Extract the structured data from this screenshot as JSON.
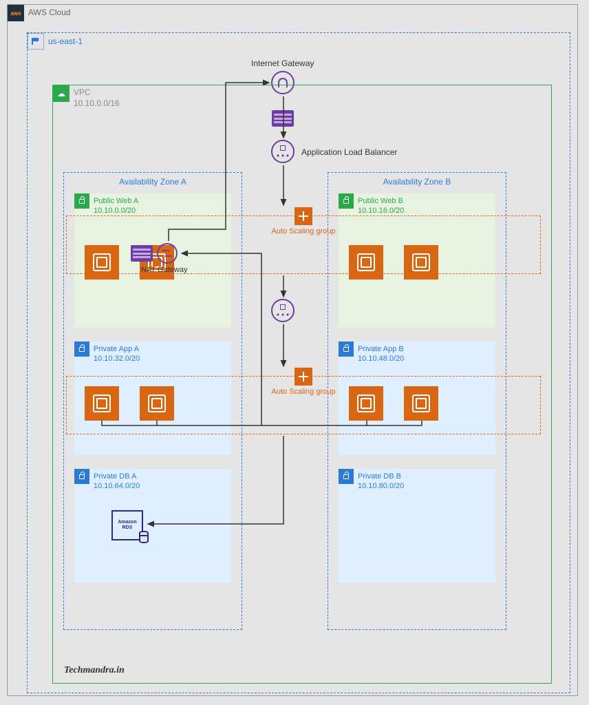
{
  "aws_cloud": {
    "label": "AWS Cloud"
  },
  "region": {
    "label": "us-east-1"
  },
  "vpc": {
    "name": "VPC",
    "cidr": "10.10.0.0/16"
  },
  "igw": {
    "label": "Internet Gateway"
  },
  "alb": {
    "label": "Application Load Balancer"
  },
  "nat": {
    "label": "NAT Gateway"
  },
  "az_a": {
    "label": "Availability Zone A"
  },
  "az_b": {
    "label": "Availability Zone B"
  },
  "subnets": {
    "public_a": {
      "name": "Public Web A",
      "cidr": "10.10.0.0/20"
    },
    "public_b": {
      "name": "Public Web B",
      "cidr": "10.10.16.0/20"
    },
    "app_a": {
      "name": "Private App A",
      "cidr": "10.10.32.0/20"
    },
    "app_b": {
      "name": "Private App B",
      "cidr": "10.10.48.0/20"
    },
    "db_a": {
      "name": "Private DB A",
      "cidr": "10.10.64.0/20"
    },
    "db_b": {
      "name": "Private DB B",
      "cidr": "10.10.80.0/20"
    }
  },
  "asg": {
    "web_label": "Auto Scaling group",
    "app_label": "Auto Scaling group"
  },
  "rds": {
    "line1": "Amazon",
    "line2": "RDS"
  },
  "watermark": "Techmandra.in"
}
